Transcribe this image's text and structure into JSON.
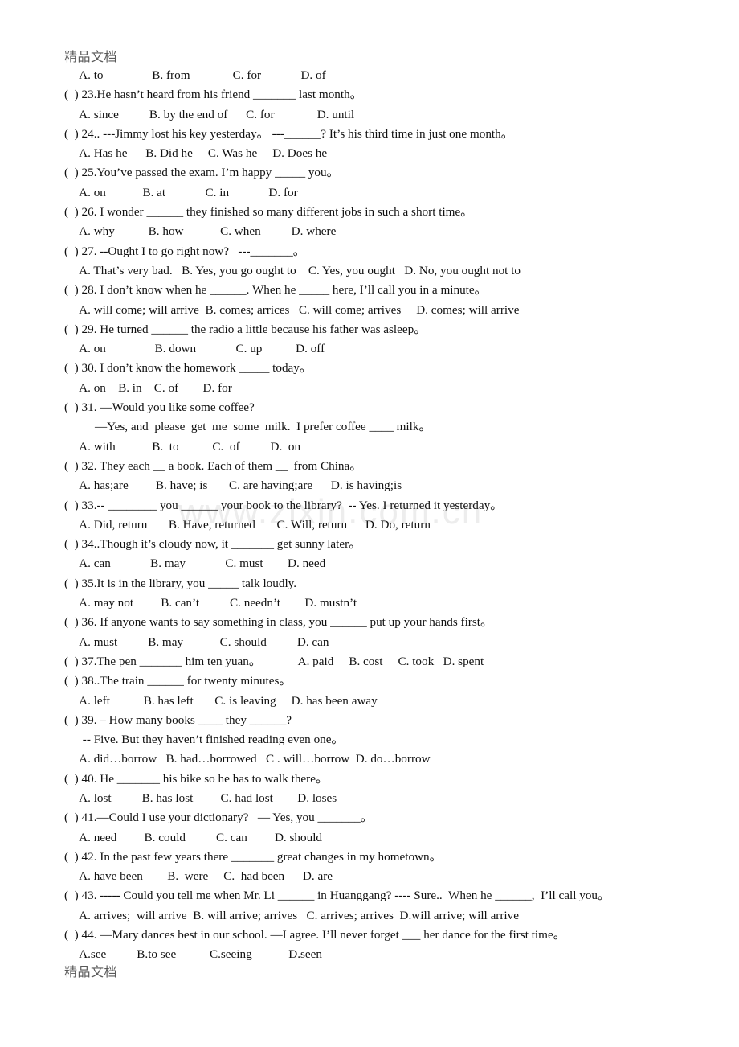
{
  "document": {
    "header_text": "精品文档",
    "footer_text": "精品文档",
    "watermark": "www.zixin.com.cn"
  },
  "lines": [
    {
      "id": "l0",
      "kind": "options",
      "text": "     A. to                B. from              C. for             D. of"
    },
    {
      "id": "l1",
      "kind": "question",
      "text": "(  ) 23.He hasn’t heard from his friend _______ last month。"
    },
    {
      "id": "l2",
      "kind": "options",
      "text": "     A. since          B. by the end of      C. for              D. until"
    },
    {
      "id": "l3",
      "kind": "question",
      "text": "(  ) 24.. ---Jimmy lost his key yesterday。 ---______? It’s his third time in just one month。"
    },
    {
      "id": "l4",
      "kind": "options",
      "text": "     A. Has he      B. Did he     C. Was he     D. Does he"
    },
    {
      "id": "l5",
      "kind": "question",
      "text": "(  ) 25.You’ve passed the exam. I’m happy _____ you。"
    },
    {
      "id": "l6",
      "kind": "options",
      "text": "     A. on            B. at             C. in             D. for"
    },
    {
      "id": "l7",
      "kind": "question",
      "text": "(  ) 26. I wonder ______ they finished so many different jobs in such a short time。"
    },
    {
      "id": "l8",
      "kind": "options",
      "text": "     A. why           B. how            C. when          D. where"
    },
    {
      "id": "l9",
      "kind": "question",
      "text": "(  ) 27. --Ought I to go right now?   ---_______。"
    },
    {
      "id": "l10",
      "kind": "options",
      "text": "     A. That’s very bad.   B. Yes, you go ought to    C. Yes, you ought   D. No, you ought not to"
    },
    {
      "id": "l11",
      "kind": "question",
      "text": "(  ) 28. I don’t know when he ______. When he _____ here, I’ll call you in a minute。"
    },
    {
      "id": "l12",
      "kind": "options",
      "text": "     A. will come; will arrive  B. comes; arrices   C. will come; arrives     D. comes; will arrive"
    },
    {
      "id": "l13",
      "kind": "question",
      "text": "(  ) 29. He turned ______ the radio a little because his father was asleep。"
    },
    {
      "id": "l14",
      "kind": "options",
      "text": "     A. on                B. down             C. up           D. off"
    },
    {
      "id": "l15",
      "kind": "question",
      "text": "(  ) 30. I don’t know the homework _____ today。"
    },
    {
      "id": "l16",
      "kind": "options",
      "text": "     A. on    B. in    C. of        D. for"
    },
    {
      "id": "l17",
      "kind": "question",
      "text": "(  ) 31. —Would you like some coffee?"
    },
    {
      "id": "l18",
      "kind": "cont",
      "text": "          —Yes, and  please  get  me  some  milk.  I prefer coffee ____ milk。"
    },
    {
      "id": "l19",
      "kind": "options",
      "text": "     A. with            B.  to           C.  of          D.  on"
    },
    {
      "id": "l20",
      "kind": "question",
      "text": "(  ) 32. They each __ a book. Each of them __  from China。"
    },
    {
      "id": "l21",
      "kind": "options",
      "text": "     A. has;are         B. have; is       C. are having;are      D. is having;is"
    },
    {
      "id": "l22",
      "kind": "question",
      "text": "(  ) 33.-- ________ you ______ your book to the library?  -- Yes. I returned it yesterday。"
    },
    {
      "id": "l23",
      "kind": "options",
      "text": "     A. Did, return       B. Have, returned       C. Will, return      D. Do, return"
    },
    {
      "id": "l24",
      "kind": "question",
      "text": "(  ) 34..Though it’s cloudy now, it _______ get sunny later。"
    },
    {
      "id": "l25",
      "kind": "options",
      "text": "     A. can             B. may             C. must        D. need"
    },
    {
      "id": "l26",
      "kind": "question",
      "text": "(  ) 35.It is in the library, you _____ talk loudly."
    },
    {
      "id": "l27",
      "kind": "options",
      "text": "     A. may not         B. can’t          C. needn’t        D. mustn’t"
    },
    {
      "id": "l28",
      "kind": "question",
      "text": "(  ) 36. If anyone wants to say something in class, you ______ put up your hands first。"
    },
    {
      "id": "l29",
      "kind": "options",
      "text": "     A. must          B. may            C. should          D. can"
    },
    {
      "id": "l30",
      "kind": "question",
      "text": "(  ) 37.The pen _______ him ten yuan。            A. paid     B. cost     C. took   D. spent"
    },
    {
      "id": "l31",
      "kind": "question",
      "text": "(  ) 38..The train ______ for twenty minutes。"
    },
    {
      "id": "l32",
      "kind": "options",
      "text": "     A. left           B. has left       C. is leaving     D. has been away"
    },
    {
      "id": "l33",
      "kind": "question",
      "text": "(  ) 39. – How many books ____ they ______?"
    },
    {
      "id": "l34",
      "kind": "cont",
      "text": "      -- Five. But they haven’t finished reading even one。"
    },
    {
      "id": "l35",
      "kind": "options",
      "text": "     A. did…borrow   B. had…borrowed   C . will…borrow  D. do…borrow"
    },
    {
      "id": "l36",
      "kind": "question",
      "text": "(  ) 40. He _______ his bike so he has to walk there。"
    },
    {
      "id": "l37",
      "kind": "options",
      "text": "     A. lost          B. has lost         C. had lost        D. loses"
    },
    {
      "id": "l38",
      "kind": "question",
      "text": "(  ) 41.—Could I use your dictionary?   — Yes, you _______。"
    },
    {
      "id": "l39",
      "kind": "options",
      "text": "     A. need         B. could          C. can         D. should"
    },
    {
      "id": "l40",
      "kind": "question",
      "text": "(  ) 42. In the past few years there _______ great changes in my hometown。"
    },
    {
      "id": "l41",
      "kind": "options",
      "text": "     A. have been        B.  were     C.  had been      D. are"
    },
    {
      "id": "l42",
      "kind": "question",
      "text": "(  ) 43. ----- Could you tell me when Mr. Li ______ in Huanggang? ---- Sure..  When he ______,  I’ll call you。"
    },
    {
      "id": "l43",
      "kind": "options",
      "text": "     A. arrives;  will arrive  B. will arrive; arrives   C. arrives; arrives  D.will arrive; will arrive"
    },
    {
      "id": "l44",
      "kind": "question",
      "text": "(  ) 44. —Mary dances best in our school. —I agree. I’ll never forget ___ her dance for the first time。"
    },
    {
      "id": "l45",
      "kind": "options",
      "text": "     A.see          B.to see           C.seeing            D.seen"
    }
  ]
}
